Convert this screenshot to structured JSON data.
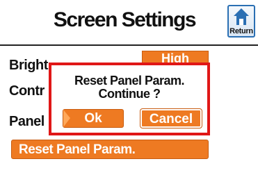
{
  "header": {
    "title": "Screen Settings",
    "return_label": "Return"
  },
  "settings": {
    "brightness_label": "Bright",
    "contrast_label": "Contr",
    "panel_label": "Panel",
    "brightness_value": "High",
    "reset_button_label": "Reset Panel Param."
  },
  "dialog": {
    "line1": "Reset Panel Param.",
    "line2": "Continue ?",
    "ok_label": "Ok",
    "cancel_label": "Cancel"
  },
  "colors": {
    "accent_orange": "#ee7a22",
    "dialog_border": "#e01717",
    "return_blue": "#2a6fb3"
  }
}
